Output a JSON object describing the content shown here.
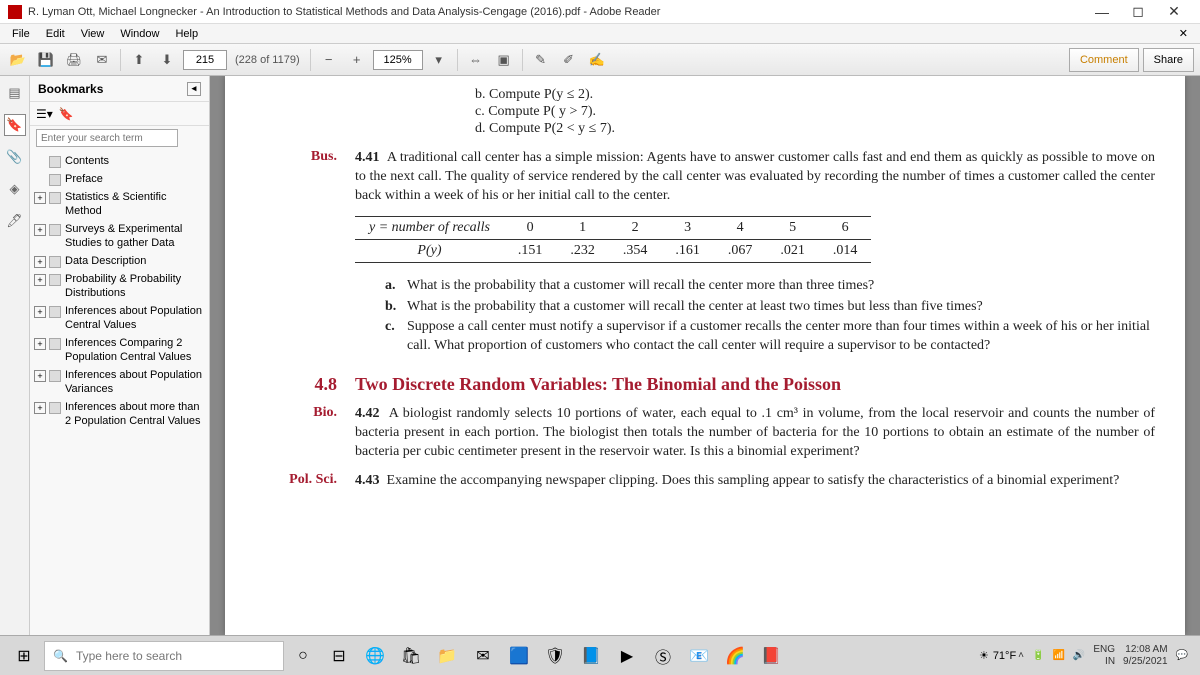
{
  "title": "R. Lyman Ott, Michael Longnecker - An Introduction to Statistical Methods and Data Analysis-Cengage (2016).pdf - Adobe Reader",
  "menu": {
    "file": "File",
    "edit": "Edit",
    "view": "View",
    "window": "Window",
    "help": "Help"
  },
  "toolbar": {
    "page_current": "215",
    "page_total": "(228 of 1179)",
    "zoom": "125%",
    "comment": "Comment",
    "share": "Share"
  },
  "bookmarks": {
    "title": "Bookmarks",
    "search_placeholder": "Enter your search term",
    "items": [
      {
        "exp": "",
        "label": "Contents"
      },
      {
        "exp": "",
        "label": "Preface"
      },
      {
        "exp": "+",
        "label": "Statistics & Scientific Method"
      },
      {
        "exp": "+",
        "label": "Surveys & Experimental Studies to gather Data"
      },
      {
        "exp": "+",
        "label": "Data Description"
      },
      {
        "exp": "+",
        "label": "Probability & Probability Distributions"
      },
      {
        "exp": "+",
        "label": "Inferences about Population Central Values"
      },
      {
        "exp": "+",
        "label": "Inferences Comparing 2 Population Central Values"
      },
      {
        "exp": "+",
        "label": "Inferences about Population Variances"
      },
      {
        "exp": "+",
        "label": "Inferences about more than 2 Population Central Values"
      }
    ]
  },
  "doc": {
    "pre_b": "b.  Compute P(y ≤ 2).",
    "pre_c": "c.  Compute P( y > 7).",
    "pre_d": "d.  Compute P(2 < y ≤ 7).",
    "p441_label": "Bus.",
    "p441_num": "4.41",
    "p441_text": "A traditional call center has a simple mission: Agents have to answer customer calls fast and end them as quickly as possible to move on to the next call. The quality of service rendered by the call center was evaluated by recording the number of times a customer called the center back within a week of his or her initial call to the center.",
    "table_h": "y = number of recalls",
    "table_h2": "P(y)",
    "table_y": [
      "0",
      "1",
      "2",
      "3",
      "4",
      "5",
      "6"
    ],
    "table_p": [
      ".151",
      ".232",
      ".354",
      ".161",
      ".067",
      ".021",
      ".014"
    ],
    "sa": "What is the probability that a customer will recall the center more than three times?",
    "sb": "What is the probability that a customer will recall the center at least two times but less than five times?",
    "sc": "Suppose a call center must notify a supervisor if a customer recalls the center more than four times within a week of his or her initial call. What proportion of customers who contact the call center will require a supervisor to be contacted?",
    "sect_num": "4.8",
    "sect_title": "Two Discrete Random Variables: The Binomial and the Poisson",
    "p442_label": "Bio.",
    "p442_num": "4.42",
    "p442_text": "A biologist randomly selects 10 portions of water, each equal to .1 cm³ in volume, from the local reservoir and counts the number of bacteria present in each portion. The biologist then totals the number of bacteria for the 10 portions to obtain an estimate of the number of bacteria per cubic centimeter present in the reservoir water. Is this a binomial experiment?",
    "p443_label": "Pol. Sci.",
    "p443_num": "4.43",
    "p443_text": "Examine the accompanying newspaper clipping. Does this sampling appear to satisfy the characteristics of a binomial experiment?"
  },
  "taskbar": {
    "search": "Type here to search",
    "temp": "71°F",
    "lang1": "ENG",
    "lang2": "IN",
    "time": "12:08 AM",
    "date": "9/25/2021"
  }
}
